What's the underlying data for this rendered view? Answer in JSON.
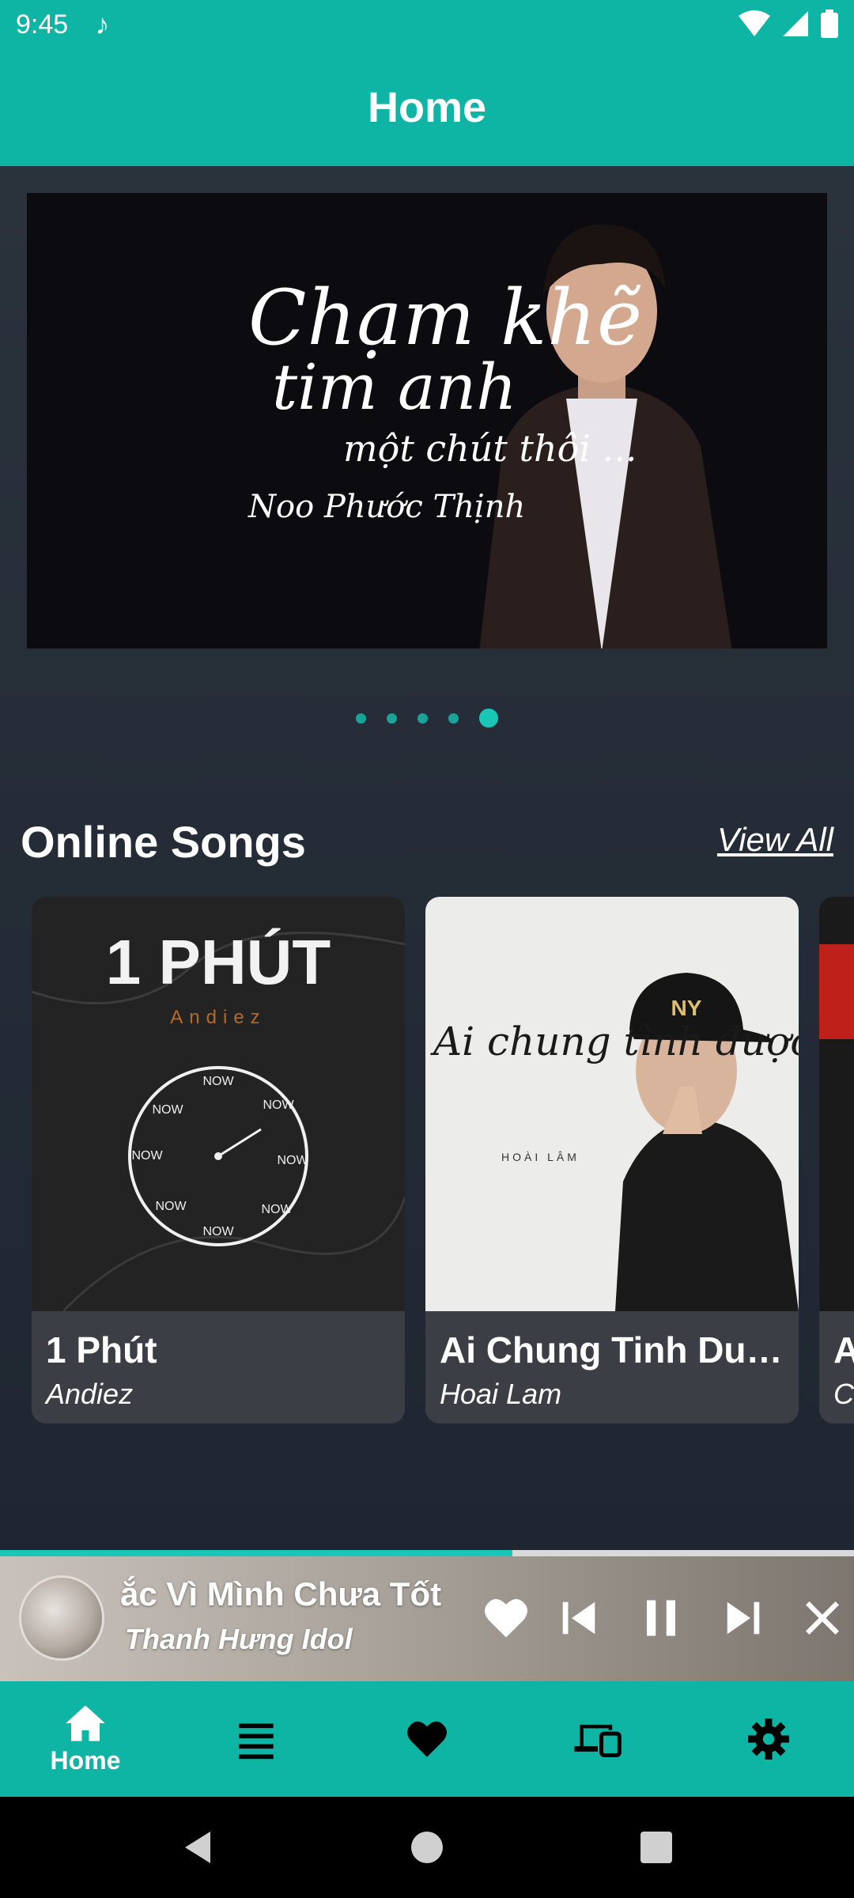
{
  "status_bar": {
    "time": "9:45"
  },
  "app_bar": {
    "title": "Home"
  },
  "banner": {
    "line1": "Chạm khẽ",
    "line2": "tim anh",
    "line3": "một chút thôi ...",
    "line4": "Noo Phước Thịnh",
    "page_count": 5,
    "active_page": 5
  },
  "online_songs": {
    "title": "Online Songs",
    "view_all": "View All",
    "cards": [
      {
        "title": "1 Phút",
        "artist": "Andiez",
        "art_text": "1 PHÚT",
        "art_subtext": "Andiez",
        "clock_label": "NOW"
      },
      {
        "title": "Ai Chung Tinh Duoc Mai",
        "artist": "Hoai Lam",
        "art_text": "Ai chung tình được mãi",
        "art_subtext": "HOÀI LÂM"
      },
      {
        "title": "A",
        "artist": "C"
      }
    ]
  },
  "mini_player": {
    "title": "ắc Vì Mình Chưa Tốt",
    "artist": "Thanh Hưng Idol",
    "progress": 0.6
  },
  "bottom_nav": {
    "items": [
      {
        "label": "Home",
        "icon": "home-icon"
      },
      {
        "label": "",
        "icon": "list-icon"
      },
      {
        "label": "",
        "icon": "heart-icon"
      },
      {
        "label": "",
        "icon": "devices-icon"
      },
      {
        "label": "",
        "icon": "gear-icon"
      }
    ]
  },
  "colors": {
    "accent": "#0fb5a4",
    "accent_light": "#19c7b6",
    "background": "#1e2530",
    "card": "#3b3e44"
  }
}
